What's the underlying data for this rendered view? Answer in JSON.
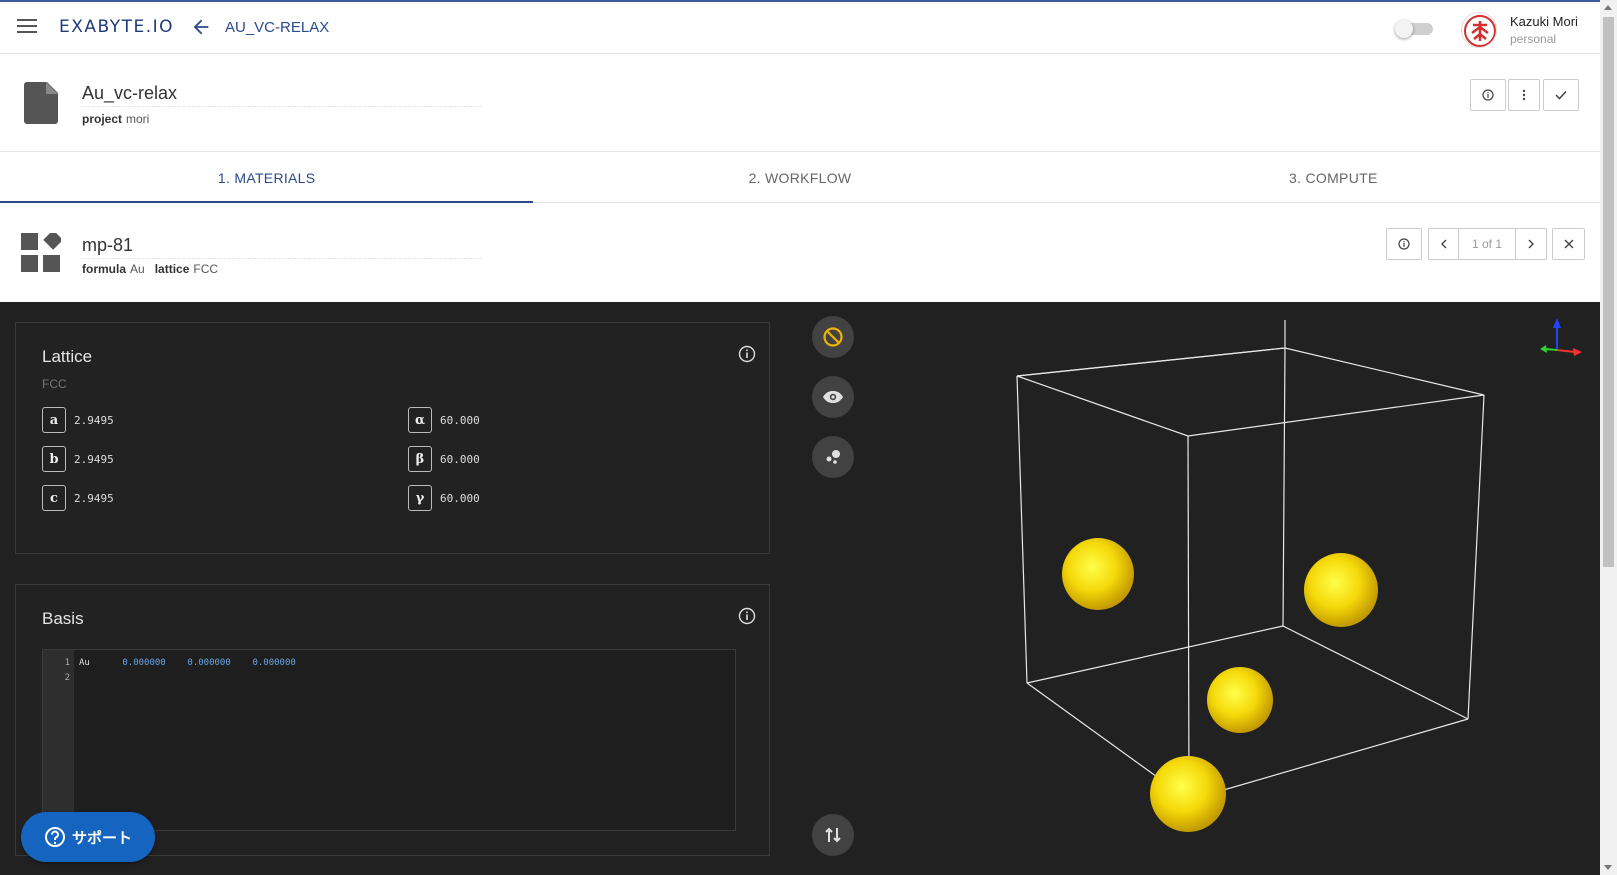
{
  "app": {
    "logo": "EXABYTE.IO",
    "breadcrumb": "AU_VC-RELAX"
  },
  "user": {
    "name": "Kazuki Mori",
    "account": "personal"
  },
  "job": {
    "title": "Au_vc-relax",
    "project_label": "project",
    "project_value": "mori"
  },
  "tabs": [
    {
      "label": "1. MATERIALS",
      "active": true
    },
    {
      "label": "2. WORKFLOW",
      "active": false
    },
    {
      "label": "3. COMPUTE",
      "active": false
    }
  ],
  "material": {
    "name": "mp-81",
    "formula_label": "formula",
    "formula_value": "Au",
    "lattice_label": "lattice",
    "lattice_value": "FCC",
    "pager": "1 of 1"
  },
  "lattice": {
    "title": "Lattice",
    "type": "FCC",
    "params": [
      {
        "key": "a",
        "value": "2.9495"
      },
      {
        "key": "b",
        "value": "2.9495"
      },
      {
        "key": "c",
        "value": "2.9495"
      },
      {
        "key": "α",
        "value": "60.000"
      },
      {
        "key": "β",
        "value": "60.000"
      },
      {
        "key": "γ",
        "value": "60.000"
      }
    ]
  },
  "basis": {
    "title": "Basis",
    "line_numbers": [
      "1",
      "2"
    ],
    "rows": [
      {
        "element": "Au",
        "x": "0.000000",
        "y": "0.000000",
        "z": "0.000000"
      }
    ]
  },
  "support": {
    "label": "サポート"
  },
  "colors": {
    "accent": "#2a4a8a",
    "atom": "#f5d90a",
    "dark_bg": "#212121",
    "support": "#1565c0"
  },
  "icons": [
    "menu-icon",
    "back-arrow-icon",
    "document-icon",
    "info-icon",
    "more-vert-icon",
    "check-icon",
    "materials-icon",
    "chevron-left-icon",
    "chevron-right-icon",
    "close-icon",
    "hide-icon",
    "eye-icon",
    "atoms-icon",
    "axes-icon",
    "swap-vert-icon",
    "help-icon"
  ]
}
